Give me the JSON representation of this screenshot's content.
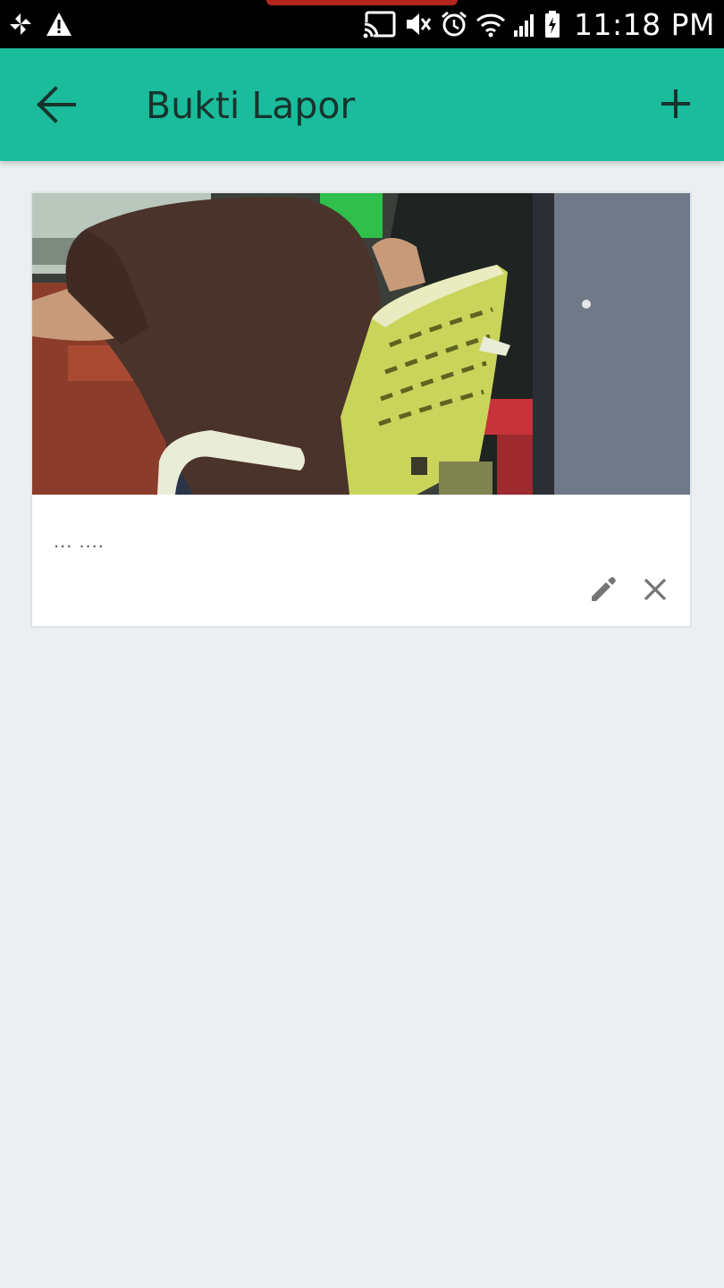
{
  "status_bar": {
    "time": "11:18 PM",
    "icons": [
      "pinwheel-icon",
      "warning-icon",
      "cast-icon",
      "mute-icon",
      "alarm-icon",
      "wifi-icon",
      "signal-icon",
      "battery-icon"
    ],
    "accent": "#b3261e"
  },
  "app_bar": {
    "title": "Bukti Lapor",
    "back_icon": "arrow-back-icon",
    "action_icon": "plus-icon",
    "background": "#1abc9c"
  },
  "evidence": {
    "items": [
      {
        "caption": "... ....",
        "photo": "photo-office-chair",
        "actions": [
          "edit-icon",
          "close-icon"
        ]
      }
    ]
  }
}
